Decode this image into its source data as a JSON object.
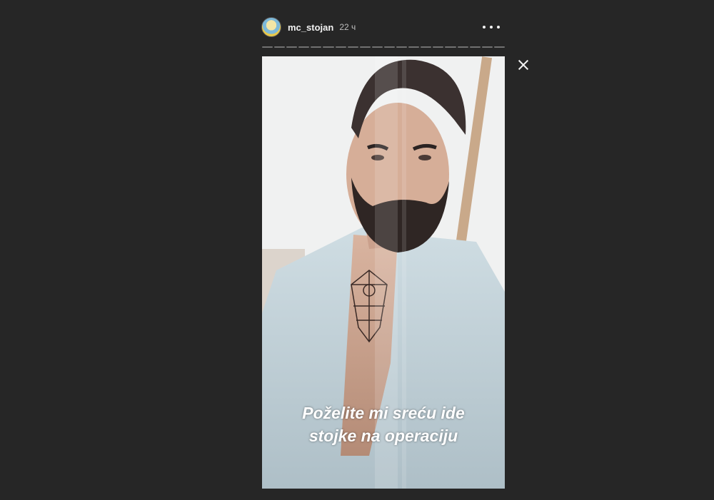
{
  "header": {
    "username": "mc_stojan",
    "timestamp": "22 ч",
    "more_icon": "more-horizontal-icon",
    "avatar_icon": "avatar"
  },
  "story": {
    "segments_total": 20,
    "segments_viewed": 0,
    "caption_line_1": "Poželite mi sreću ide",
    "caption_line_2": "stojke na operaciju"
  },
  "controls": {
    "close_icon": "close-icon"
  }
}
